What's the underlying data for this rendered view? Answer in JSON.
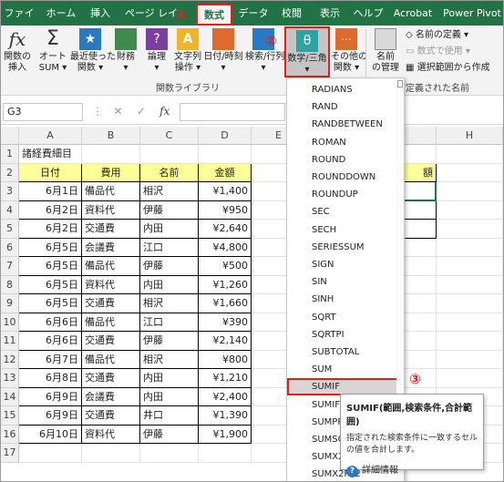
{
  "markers": {
    "one": "①",
    "two": "②",
    "three": "③"
  },
  "tabs": [
    {
      "label": "ファイル"
    },
    {
      "label": "ホーム"
    },
    {
      "label": "挿入"
    },
    {
      "label": "ページ レイア"
    },
    {
      "label": "数式",
      "active": true
    },
    {
      "label": "データ"
    },
    {
      "label": "校閲"
    },
    {
      "label": "表示"
    },
    {
      "label": "ヘルプ"
    },
    {
      "label": "Acrobat"
    },
    {
      "label": "Power Pivot"
    }
  ],
  "ribbon": {
    "insert_function": "関数の\n挿入",
    "autosum": "オート\nSUM ▾",
    "recent": "最近使った\n関数 ▾",
    "financial": "財務\n▾",
    "logical": "論理\n▾",
    "text": "文字列\n操作 ▾",
    "datetime": "日付/時刻\n▾",
    "lookup": "検索/行列\n▾",
    "math": "数学/三角\n▾",
    "more": "その他の\n関数 ▾",
    "group_label": "関数ライブラリ",
    "name_manager": "名前\nの管理",
    "define_name": "名前の定義 ▾",
    "use_in_formula": "数式で使用 ▾",
    "create_from_selection": "選択範囲から作成",
    "defined_names_label": "定義された名前"
  },
  "formula_bar": {
    "name_box": "G3",
    "fx": "fx"
  },
  "columns": [
    "A",
    "B",
    "C",
    "D",
    "E",
    "F",
    "G",
    "H"
  ],
  "title_cell": "諸経費細目",
  "headers": [
    "日付",
    "費用",
    "名前",
    "金額"
  ],
  "g2_header": "額",
  "rows": [
    [
      "6月1日",
      "備品代",
      "相沢",
      "¥1,400"
    ],
    [
      "6月2日",
      "資料代",
      "伊藤",
      "¥950"
    ],
    [
      "6月2日",
      "交通費",
      "内田",
      "¥2,640"
    ],
    [
      "6月5日",
      "会議費",
      "江口",
      "¥4,800"
    ],
    [
      "6月5日",
      "備品代",
      "伊藤",
      "¥500"
    ],
    [
      "6月5日",
      "資料代",
      "内田",
      "¥1,260"
    ],
    [
      "6月5日",
      "交通費",
      "相沢",
      "¥1,660"
    ],
    [
      "6月6日",
      "備品代",
      "江口",
      "¥390"
    ],
    [
      "6月6日",
      "交通費",
      "伊藤",
      "¥2,140"
    ],
    [
      "6月7日",
      "備品代",
      "相沢",
      "¥800"
    ],
    [
      "6月8日",
      "交通費",
      "内田",
      "¥1,210"
    ],
    [
      "6月9日",
      "会議費",
      "内田",
      "¥2,400"
    ],
    [
      "6月9日",
      "交通費",
      "井口",
      "¥1,390"
    ],
    [
      "6月10日",
      "資料代",
      "伊藤",
      "¥1,900"
    ]
  ],
  "row_numbers": [
    "1",
    "2",
    "3",
    "4",
    "5",
    "6",
    "7",
    "8",
    "9",
    "10",
    "11",
    "12",
    "13",
    "14",
    "15",
    "16",
    "17"
  ],
  "dropdown_items": [
    "RADIANS",
    "RAND",
    "RANDBETWEEN",
    "ROMAN",
    "ROUND",
    "ROUNDDOWN",
    "ROUNDUP",
    "SEC",
    "SECH",
    "SERIESSUM",
    "SIGN",
    "SIN",
    "SINH",
    "SQRT",
    "SQRTPI",
    "SUBTOTAL",
    "SUM",
    "SUMIF",
    "SUMIFS",
    "SUMPRODUCT",
    "SUMSQ",
    "SUMX2MY2",
    "SUMX2PY2"
  ],
  "dropdown_selected": "SUMIF",
  "tooltip": {
    "title": "SUMIF(範囲,検索条件,合計範囲)",
    "desc": "指定された検索条件に一致するセルの値を合計します。",
    "more": "詳細情報"
  },
  "colors": {
    "excel_green": "#217346",
    "highlight_red": "#e0201b",
    "header_yellow": "#ffff99"
  }
}
